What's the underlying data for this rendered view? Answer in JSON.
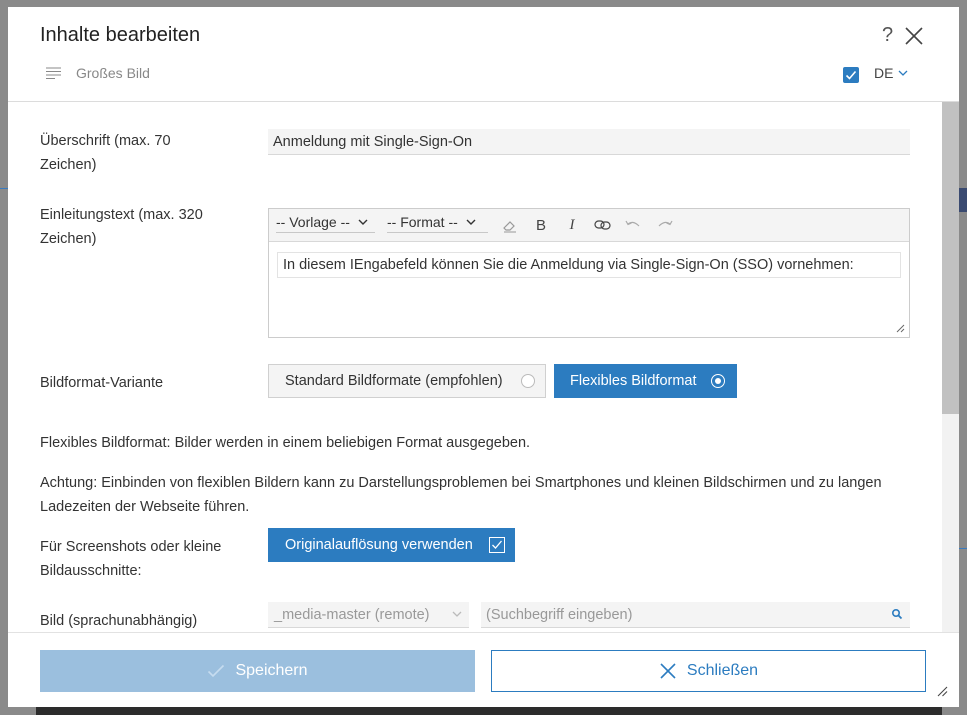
{
  "dialog": {
    "title": "Inhalte bearbeiten",
    "help_label": "?",
    "content_type_label": "Großes Bild",
    "language": "DE"
  },
  "form": {
    "heading": {
      "label": "Überschrift (max. 70 Zeichen)",
      "value": "Anmeldung mit Single-Sign-On"
    },
    "intro": {
      "label": "Einleitungstext (max. 320 Zeichen)",
      "template_select": "-- Vorlage --",
      "format_select": "-- Format --",
      "bold_label": "B",
      "italic_label": "I",
      "content": "In diesem IEngabefeld können Sie die Anmeldung via Single-Sign-On (SSO) vornehmen:"
    },
    "image_format": {
      "label": "Bildformat-Variante",
      "standard_option": "Standard Bildformate (empfohlen)",
      "flexible_option": "Flexibles Bildformat",
      "selected": "flexible"
    },
    "info_1": "Flexibles Bildformat: Bilder werden in einem beliebigen Format ausgegeben.",
    "info_2": "Achtung: Einbinden von flexiblen Bildern kann zu Darstellungsproblemen bei Smartphones und kleinen Bildschirmen und zu langen Ladezeiten der Webseite führen.",
    "original_resolution": {
      "label": "Für Screenshots oder kleine Bildausschnitte:",
      "button_label": "Originalauflösung verwenden",
      "checked": true
    },
    "image": {
      "label": "Bild (sprachunabhängig)",
      "source_select": "_media-master (remote)",
      "search_placeholder": "(Suchbegriff eingeben)"
    }
  },
  "footer": {
    "save_label": "Speichern",
    "close_label": "Schließen"
  },
  "colors": {
    "accent": "#2c7cc0",
    "save_disabled": "#9bbfde"
  },
  "icons": {
    "close": "close-icon",
    "content_type": "text-lines-icon",
    "language_chevron": "chevron-down-icon",
    "eraser": "eraser-icon",
    "link": "link-icon",
    "undo": "undo-icon",
    "redo": "redo-icon",
    "search": "search-icon",
    "check": "check-icon"
  }
}
